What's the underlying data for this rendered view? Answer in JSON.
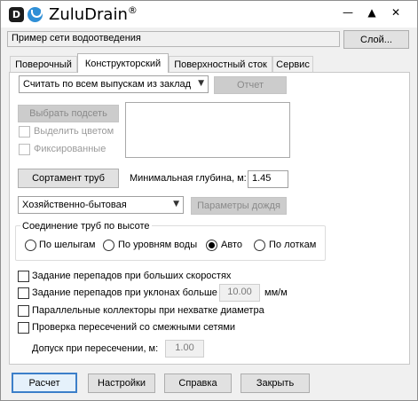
{
  "app": {
    "brand_letter": "D",
    "title": "ZuluDrain",
    "reg": "®"
  },
  "window_controls": {
    "minimize": "—",
    "maximize": "▲",
    "close": "✕"
  },
  "header": {
    "network_name": "Пример сети водоотведения",
    "layer_button": "Слой..."
  },
  "tabs": [
    {
      "label": "Поверочный"
    },
    {
      "label": "Конструкторский"
    },
    {
      "label": "Поверхностный сток"
    },
    {
      "label": "Сервис"
    }
  ],
  "design": {
    "outlet_select": "Считать по всем выпускам из заклад",
    "report_button": "Отчет",
    "select_subnet_button": "Выбрать подсеть",
    "highlight_color_label": "Выделить цветом",
    "fixed_label": "Фиксированные",
    "pipe_assortment_button": "Сортамент труб",
    "min_depth_label": "Минимальная глубина, м:",
    "min_depth_value": "1.45",
    "sewage_type_select": "Хозяйственно-бытовая",
    "rain_params_button": "Параметры дождя",
    "connection_group_title": "Соединение труб по высоте",
    "connection_options": [
      {
        "label": "По шелыгам",
        "checked": false
      },
      {
        "label": "По уровням воды",
        "checked": false
      },
      {
        "label": "Авто",
        "checked": true
      },
      {
        "label": "По лоткам",
        "checked": false
      }
    ],
    "drops_high_speed_label": "Задание перепадов при больших скоростях",
    "drops_slope_label": "Задание перепадов при уклонах больше",
    "drops_slope_value": "10.00",
    "drops_slope_unit": "мм/м",
    "parallel_collectors_label": "Параллельные коллекторы при нехватке диаметра",
    "intersection_check_label": "Проверка пересечений со смежными сетями",
    "intersection_tolerance_label": "Допуск при пересечении, м:",
    "intersection_tolerance_value": "1.00"
  },
  "footer": {
    "calculate": "Расчет",
    "settings": "Настройки",
    "help": "Справка",
    "close": "Закрыть"
  }
}
